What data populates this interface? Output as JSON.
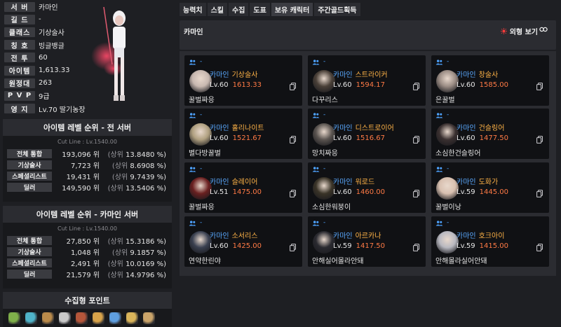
{
  "profile": {
    "rows": [
      {
        "label": "서 버",
        "value": "카마인"
      },
      {
        "label": "길 드",
        "value": "-"
      },
      {
        "label": "클래스",
        "value": "기상술사"
      },
      {
        "label": "칭 호",
        "value": "빙글뱅글"
      },
      {
        "label": "전 투",
        "value": "60"
      },
      {
        "label": "아이템",
        "value": "1,613.33"
      },
      {
        "label": "원정대",
        "value": "263"
      },
      {
        "label": "P V P",
        "value": "9급"
      },
      {
        "label": "영 지",
        "value": "Lv.70 딸기농장"
      }
    ]
  },
  "rank_all": {
    "title": "아이템 레벨 순위 - 전 서버",
    "cutline": "Cut Line : Lv.1540.00",
    "rows": [
      {
        "label": "전체 통합",
        "pos": "193,096 위",
        "pct_pre": "(상위",
        "pct": "13.8480 %)"
      },
      {
        "label": "기상술사",
        "pos": "7,723 위",
        "pct_pre": "(상위",
        "pct": "8.6908 %)"
      },
      {
        "label": "스페셜리스트",
        "pos": "19,431 위",
        "pct_pre": "(상위",
        "pct": "9.7439 %)"
      },
      {
        "label": "딜러",
        "pos": "149,590 위",
        "pct_pre": "(상위",
        "pct": "13.5406 %)"
      }
    ]
  },
  "rank_server": {
    "title": "아이템 레벨 순위 - 카마인 서버",
    "cutline": "Cut Line : Lv.1540.00",
    "rows": [
      {
        "label": "전체 통합",
        "pos": "27,850 위",
        "pct_pre": "(상위",
        "pct": "15.3186 %)"
      },
      {
        "label": "기상술사",
        "pos": "1,048 위",
        "pct_pre": "(상위",
        "pct": "9.1857 %)"
      },
      {
        "label": "스페셜리스트",
        "pos": "2,491 위",
        "pct_pre": "(상위",
        "pct": "10.0169 %)"
      },
      {
        "label": "딜러",
        "pos": "21,579 위",
        "pct_pre": "(상위",
        "pct": "14.9796 %)"
      }
    ]
  },
  "collect": {
    "title": "수집형 포인트",
    "icons": [
      {
        "name": "mokoko-seed-icon",
        "color": "#7fb04a"
      },
      {
        "name": "island-heart-icon",
        "color": "#4fb3c9"
      },
      {
        "name": "art-icon",
        "color": "#b98a4a"
      },
      {
        "name": "giants-heart-icon",
        "color": "#c9c9c9"
      },
      {
        "name": "ignea-token-icon",
        "color": "#b5563a"
      },
      {
        "name": "sea-bounty-icon",
        "color": "#d8a34a"
      },
      {
        "name": "world-tree-leaf-icon",
        "color": "#5f9fe0"
      },
      {
        "name": "orpheus-star-icon",
        "color": "#d9b45a"
      },
      {
        "name": "orgel-icon",
        "color": "#caa46a"
      }
    ]
  },
  "tabs": [
    "능력치",
    "스킬",
    "수집",
    "도표",
    "보유 캐릭터",
    "주간골드획득"
  ],
  "active_tab": 4,
  "header": {
    "server": "카마인",
    "appearance": "외형 보기"
  },
  "characters": [
    {
      "server": "카마인",
      "cls": "기상술사",
      "level": "Lv.60",
      "ilvl": "1613.33",
      "guild": "꿀벌짜응",
      "face": "#c8b8b0"
    },
    {
      "server": "카마인",
      "cls": "스트라이커",
      "level": "Lv.60",
      "ilvl": "1594.17",
      "guild": "다꾸리스",
      "face": "#4a4038"
    },
    {
      "server": "카마인",
      "cls": "창술사",
      "level": "Lv.60",
      "ilvl": "1585.00",
      "guild": "은꿀벌",
      "face": "#9a8c84"
    },
    {
      "server": "카마인",
      "cls": "홀리나이트",
      "level": "Lv.60",
      "ilvl": "1521.67",
      "guild": "별다방꿀벌",
      "face": "#b0a080"
    },
    {
      "server": "카마인",
      "cls": "디스트로이어",
      "level": "Lv.60",
      "ilvl": "1516.67",
      "guild": "망치짜응",
      "face": "#5a5450"
    },
    {
      "server": "카마인",
      "cls": "건슬링어",
      "level": "Lv.60",
      "ilvl": "1477.50",
      "guild": "소심한건슬링어",
      "face": "#3a3030"
    },
    {
      "server": "카마인",
      "cls": "슬레이어",
      "level": "Lv.51",
      "ilvl": "1475.00",
      "guild": "꿀벌짜응",
      "face": "#6a2020"
    },
    {
      "server": "카마인",
      "cls": "워로드",
      "level": "Lv.60",
      "ilvl": "1460.00",
      "guild": "소심한워붕이",
      "face": "#3a3428"
    },
    {
      "server": "카마인",
      "cls": "도화가",
      "level": "Lv.59",
      "ilvl": "1445.00",
      "guild": "꿀벌이낭",
      "face": "#d8c0b0"
    },
    {
      "server": "카마인",
      "cls": "소서리스",
      "level": "Lv.60",
      "ilvl": "1425.00",
      "guild": "연약한린야",
      "face": "#3a4050"
    },
    {
      "server": "카마인",
      "cls": "아르카나",
      "level": "Lv.59",
      "ilvl": "1417.50",
      "guild": "안해실어몰라안돼",
      "face": "#2a2a30"
    },
    {
      "server": "카마인",
      "cls": "호크아이",
      "level": "Lv.59",
      "ilvl": "1415.00",
      "guild": "안해몰라실어안돼",
      "face": "#b8b8c0"
    }
  ],
  "char_dash": "-",
  "colors": {
    "accent_blue": "#5aa9ff",
    "class_orange": "#ffb347",
    "ilvl_orange": "#ff7a45",
    "appearance_red": "#ff3b3b"
  }
}
